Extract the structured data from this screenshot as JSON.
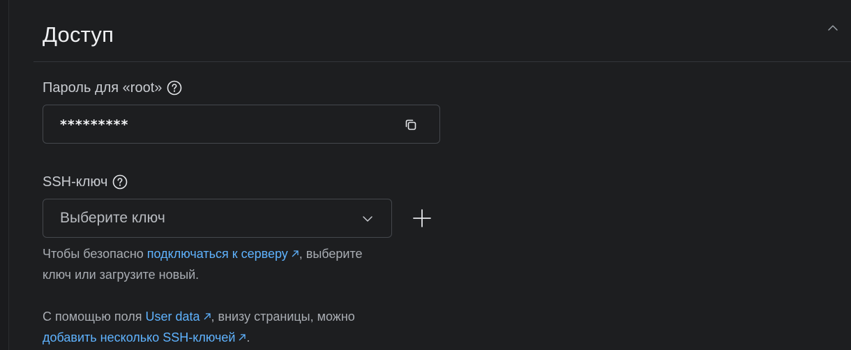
{
  "section": {
    "title": "Доступ"
  },
  "password": {
    "label": "Пароль для «root»",
    "value": "*********"
  },
  "ssh": {
    "label": "SSH-ключ",
    "select_placeholder": "Выберите ключ"
  },
  "hint1": {
    "before": "Чтобы безопасно ",
    "link": "подключаться к серверу",
    "after1": ", выберите",
    "after2": "ключ или загрузите новый."
  },
  "hint2": {
    "before": "С помощью поля ",
    "link1": "User data",
    "middle": ", внизу страницы, можно",
    "link2": "добавить несколько SSH-ключей",
    "after": "."
  },
  "icons": {
    "collapse": "chevron-up-icon",
    "help": "question-circle-icon",
    "copy": "copy-icon",
    "dropdown": "chevron-down-icon",
    "add": "plus-icon",
    "external": "external-link-arrow-icon"
  },
  "colors": {
    "background": "#1d1e20",
    "link": "#5fb3ff",
    "text": "#f0f1f3",
    "muted": "#a9adb3",
    "border": "#45484d"
  }
}
